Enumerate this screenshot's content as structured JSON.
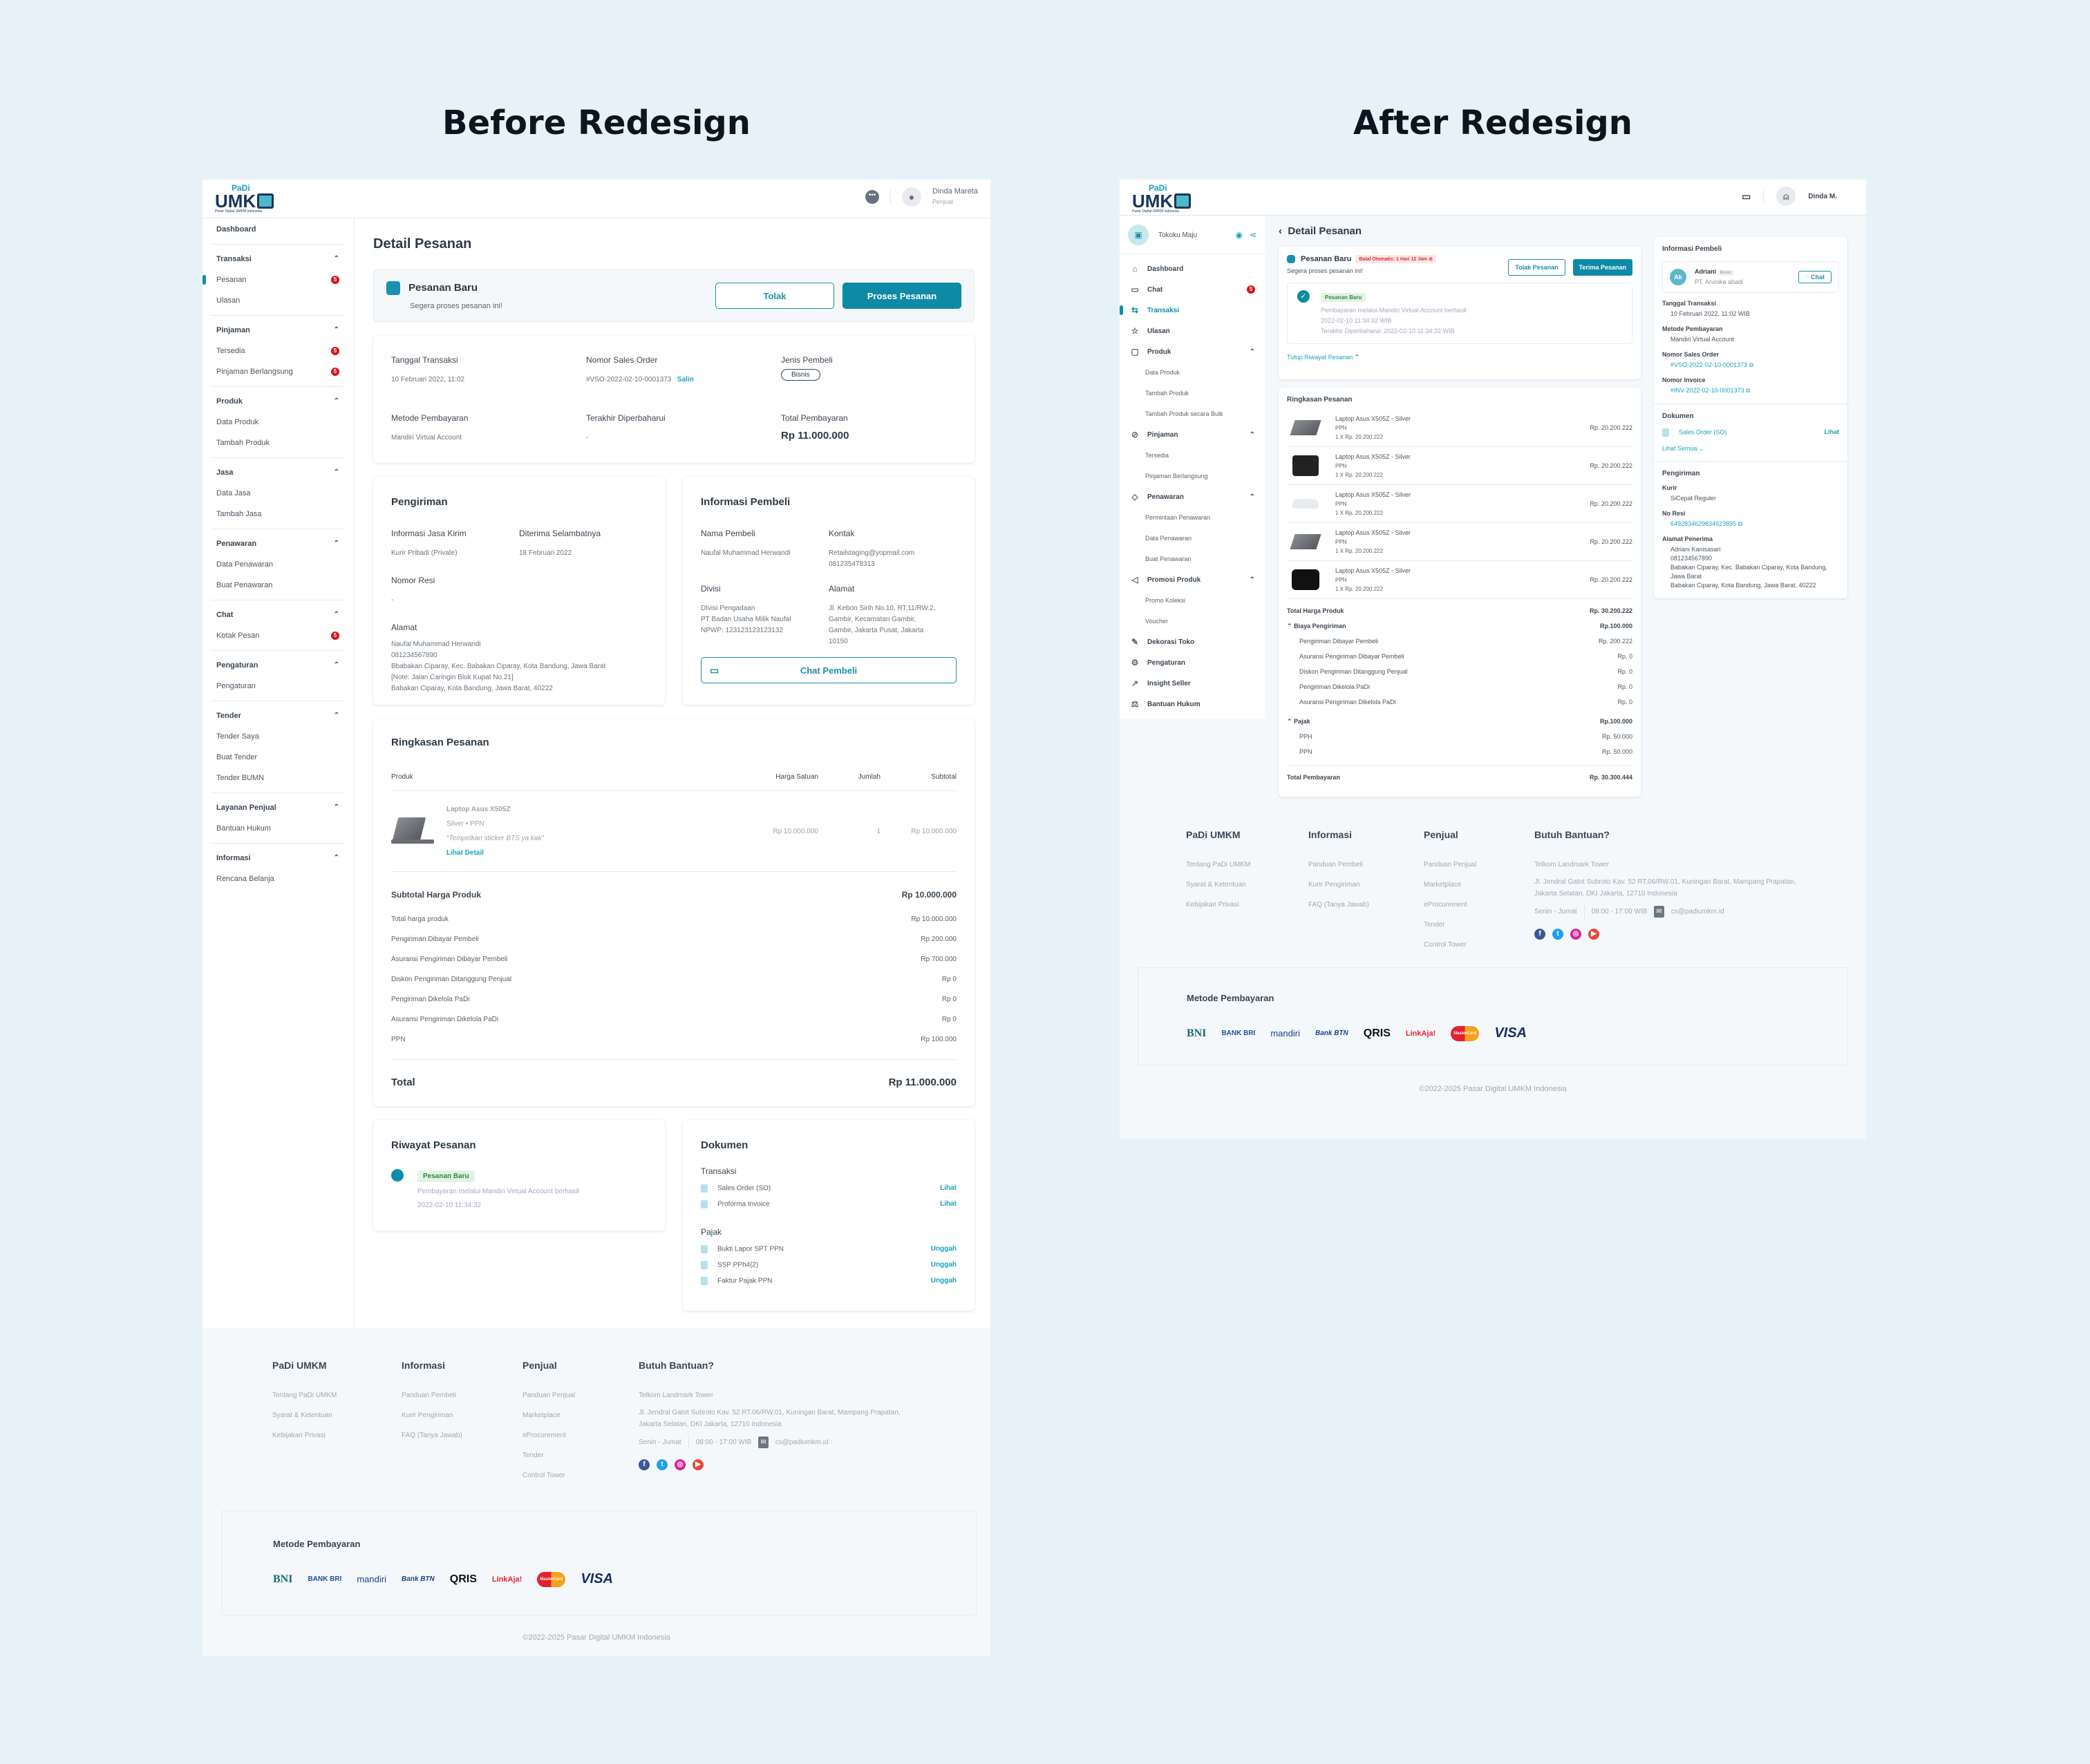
{
  "headings": {
    "before": "Before Redesign",
    "after": "After Redesign"
  },
  "brand": {
    "small": "PaDi",
    "big": "UMK",
    "tagline": "Pasar Digital UMKM Indonesia"
  },
  "before": {
    "user": {
      "name": "Dinda Mareta",
      "role": "Penjual"
    },
    "sidebar": [
      {
        "title": "Dashboard",
        "items": []
      },
      {
        "title": "Transaksi",
        "items": [
          {
            "label": "Pesanan",
            "badge": "5",
            "active": true
          },
          {
            "label": "Ulasan"
          }
        ]
      },
      {
        "title": "Pinjaman",
        "items": [
          {
            "label": "Tersedia",
            "badge": "5"
          },
          {
            "label": "Pinjaman Berlangsung",
            "badge": "5"
          }
        ]
      },
      {
        "title": "Produk",
        "items": [
          {
            "label": "Data Produk"
          },
          {
            "label": "Tambah Produk"
          }
        ]
      },
      {
        "title": "Jasa",
        "items": [
          {
            "label": "Data Jasa"
          },
          {
            "label": "Tambah Jasa"
          }
        ]
      },
      {
        "title": "Penawaran",
        "items": [
          {
            "label": "Data Penawaran"
          },
          {
            "label": "Buat Penawaran"
          }
        ]
      },
      {
        "title": "Chat",
        "items": [
          {
            "label": "Kotak Pesan",
            "badge": "5"
          }
        ]
      },
      {
        "title": "Pengaturan",
        "items": [
          {
            "label": "Pengaturan"
          }
        ]
      },
      {
        "title": "Tender",
        "items": [
          {
            "label": "Tender Saya"
          },
          {
            "label": "Buat Tender"
          },
          {
            "label": "Tender BUMN"
          }
        ]
      },
      {
        "title": "Layanan Penjual",
        "items": [
          {
            "label": "Bantuan Hukum"
          }
        ]
      },
      {
        "title": "Informasi",
        "items": [
          {
            "label": "Rencana Belanja"
          }
        ]
      }
    ],
    "title": "Detail Pesanan",
    "alert": {
      "title": "Pesanan Baru",
      "subtitle": "Segera proses pesanan ini!",
      "reject": "Tolak",
      "process": "Proses Pesanan"
    },
    "info": {
      "tanggal_label": "Tanggal Transaksi",
      "tanggal": "10 Februari 2022, 11:02",
      "so_label": "Nomor Sales Order",
      "so": "#VSO-2022-02-10-0001373",
      "copy": "Salin",
      "jenis_label": "Jenis Pembeli",
      "jenis": "Bisnis",
      "metode_label": "Metode Pembayaran",
      "metode": "Mandiri Virtual Account",
      "update_label": "Terakhir Diperbaharui",
      "update": "-",
      "total_label": "Total Pembayaran",
      "total": "Rp 11.000.000"
    },
    "shipping": {
      "title": "Pengiriman",
      "jasa_label": "Informasi Jasa Kirim",
      "jasa": "Kurir Pribadi (Private)",
      "eta_label": "Diterima Selambatnya",
      "eta": "18 Februari 2022",
      "resi_label": "Nomor Resi",
      "resi": "-",
      "alamat_label": "Alamat",
      "alamat": [
        "Naufal Muhammad Herwandi",
        "081234567890",
        "Bbabakan Ciparay, Kec. Babakan Ciparay, Kota Bandung, Jawa Barat",
        "[Note: Jalan Caringin Blok Kupat No.21]",
        "Babakan Ciparay, Kota Bandung, Jawa Barat, 40222"
      ]
    },
    "buyer": {
      "title": "Informasi Pembeli",
      "nama_label": "Nama Pembeli",
      "nama": "Naufal Muhammad Herwandi",
      "kontak_label": "Kontak",
      "kontak": [
        "Retailstaging@yopmail.com",
        "081235478313"
      ],
      "divisi_label": "Divisi",
      "divisi": [
        "DIvisi Pengadaan",
        "PT Badan Usaha Milik Naufal",
        "NPWP: 123123123123132"
      ],
      "alamat_label": "Alamat",
      "alamat": [
        "Jl. Kebon Sirih No.10, RT.11/RW.2,",
        "Gambir, Kecamatan Gambir,",
        "Gambir, Jakarta Pusat, Jakarta",
        "10150"
      ],
      "chat": "Chat Pembeli"
    },
    "summary": {
      "title": "Ringkasan Pesanan",
      "columns": [
        "Produk",
        "Harga Satuan",
        "Jumlah",
        "Subtotal"
      ],
      "product": {
        "name": "Laptop Asus X505Z",
        "variant": "Silver",
        "tax": "PPN",
        "note": "“Tempelkan sticker BTS ya kak”",
        "detail": "Lihat Detail",
        "price": "Rp 10.000.000",
        "qty": "1",
        "subtotal": "Rp 10.000.000"
      },
      "subtotal": {
        "label": "Subtotal Harga Produk",
        "value": "Rp 10.000.000"
      },
      "lines": [
        {
          "label": "Total harga produk",
          "value": "Rp 10.000.000"
        },
        {
          "label": "Pengiriman Dibayar Pembeli",
          "value": "Rp 200.000"
        },
        {
          "label": "Asuransi Pengiriman Dibayar Pembeli",
          "value": "Rp 700.000"
        },
        {
          "label": "Diskon Pengiriman Ditanggung Penjual",
          "value": "Rp 0"
        },
        {
          "label": "Pengiriman Dikelola PaDi",
          "value": "Rp 0"
        },
        {
          "label": "Asuransi Pengiriman Dikelola PaDi",
          "value": "Rp 0"
        },
        {
          "label": "PPN",
          "value": "Rp 100.000"
        }
      ],
      "total": {
        "label": "Total",
        "value": "Rp 11.000.000"
      }
    },
    "history": {
      "title": "Riwayat Pesanan",
      "status": "Pesanan Baru",
      "desc": "Pembayaran melalui Mandiri Virtual Account berhasil",
      "time": "2022-02-10 11:34:32"
    },
    "docs": {
      "title": "Dokumen",
      "groups": [
        {
          "title": "Transaksi",
          "items": [
            {
              "label": "Sales Order (SO)",
              "action": "Lihat"
            },
            {
              "label": "Proforma Invoice",
              "action": "Lihat"
            }
          ]
        },
        {
          "title": "Pajak",
          "items": [
            {
              "label": "Bukti Lapor SPT PPN",
              "action": "Unggah"
            },
            {
              "label": "SSP PPh4(2)",
              "action": "Unggah"
            },
            {
              "label": "Faktur Pajak PPN",
              "action": "Unggah"
            }
          ]
        }
      ]
    }
  },
  "footer": {
    "cols": [
      {
        "title": "PaDi UMKM",
        "items": [
          "Tentang PaDi UMKM",
          "Syarat & Ketentuan",
          "Kebijakan Privasi"
        ]
      },
      {
        "title": "Informasi",
        "items": [
          "Panduan Pembeli",
          "Kurir Pengiriman",
          "FAQ (Tanya Jawab)"
        ]
      },
      {
        "title": "Penjual",
        "items": [
          "Panduan Penjual",
          "Marketplace",
          "eProcurement",
          "Tender",
          "Control Tower"
        ]
      }
    ],
    "help": {
      "title": "Butuh Bantuan?",
      "place": "Telkom Landmark Tower",
      "address": "Jl. Jendral Gatot Subroto Kav. 52 RT.06/RW.01, Kuningan Barat, Mampang Prapatan, Jakarta Selatan, DKI Jakarta, 12710 Indonesia",
      "days": "Senin - Jumat",
      "hours": "08:00 - 17:00 WIB",
      "email": "cs@padiumkm.id"
    },
    "socials": [
      "facebook",
      "twitter",
      "instagram",
      "youtube"
    ],
    "payment_title": "Metode Pembayaran",
    "payments": [
      "BNI",
      "BANK BRI",
      "mandiri",
      "Bank BTN",
      "QRIS",
      "LinkAja!",
      "MasterCard",
      "VISA"
    ],
    "copyright": "©2022-2025 Pasar Digital UMKM Indonesia"
  },
  "after": {
    "user": {
      "name": "Dinda M."
    },
    "shop": {
      "name": "Tokoku Maju"
    },
    "sidebar": [
      {
        "label": "Dashboard",
        "icon": "home"
      },
      {
        "label": "Chat",
        "icon": "chat",
        "badge": "5"
      },
      {
        "label": "Transaksi",
        "icon": "transaction",
        "active": true
      },
      {
        "label": "Ulasan",
        "icon": "star"
      },
      {
        "label": "Produk",
        "icon": "bag",
        "sub": [
          "Data Produk",
          "Tambah Produk",
          "Tambah Produk secara Bulk"
        ]
      },
      {
        "label": "Pinjaman",
        "icon": "loan",
        "sub": [
          "Tersedia",
          "Pinjaman Berlangsung"
        ]
      },
      {
        "label": "Penawaran",
        "icon": "tag",
        "sub": [
          "Permintaan Penawaran",
          "Data Penawaran",
          "Buat Penawaran"
        ]
      },
      {
        "label": "Promosi Produk",
        "icon": "megaphone",
        "sub": [
          "Promo Koleksi",
          "Voucher"
        ]
      },
      {
        "label": "Dekorasi Toko",
        "icon": "brush"
      },
      {
        "label": "Pengaturan",
        "icon": "gear"
      },
      {
        "label": "Insight Seller",
        "icon": "trend"
      },
      {
        "label": "Bantuan Hukum",
        "icon": "scale"
      }
    ],
    "title": "Detail Pesanan",
    "status": {
      "title": "Pesanan Baru",
      "timer": "Batal Otomatis: 1 Hari 12 Jam",
      "subtitle": "Segera proses pesanan ini!",
      "reject": "Tolak Pesanan",
      "accept": "Terima Pesanan",
      "history_tag": "Pesanan Baru",
      "history_desc": "Pembayaran melalui Mandiri Virtual Account berhasil",
      "history_time": "2022-02-10 11:34:32 WIB",
      "history_update": "Terakhir Diperbaharui: 2022-02-10 11:34:32 WIB",
      "toggle": "Tutup Riwayat Pesanan"
    },
    "summary": {
      "title": "Ringkasan Pesanan",
      "products": [
        {
          "name": "Laptop Asus X505Z - Silver",
          "tax": "PPN",
          "qty": "1 X Rp. 20.200.222",
          "price": "Rp. 20.200.222",
          "img": "laptop"
        },
        {
          "name": "Laptop Asus X505Z - Silver",
          "tax": "PPN",
          "qty": "1 X Rp. 20.200.222",
          "price": "Rp. 20.200.222",
          "img": "camera"
        },
        {
          "name": "Laptop Asus X505Z - Silver",
          "tax": "PPN",
          "qty": "1 X Rp. 20.200.222",
          "price": "Rp. 20.200.222",
          "img": "shoe"
        },
        {
          "name": "Laptop Asus X505Z - Silver",
          "tax": "PPN",
          "qty": "1 X Rp. 20.200.222",
          "price": "Rp. 20.200.222",
          "img": "laptop"
        },
        {
          "name": "Laptop Asus X505Z - Silver",
          "tax": "PPN",
          "qty": "1 X Rp. 20.200.222",
          "price": "Rp. 20.200.222",
          "img": "bag"
        }
      ],
      "total_products": {
        "label": "Total Harga Produk",
        "value": "Rp. 30.200.222"
      },
      "shipping": {
        "label": "Biaya Pengiriman",
        "value": "Rp.100.000",
        "lines": [
          {
            "label": "Pengiriman Dibayar Pembeli",
            "value": "Rp. 200.222"
          },
          {
            "label": "Asuransi Pengiriman Dibayar Pembeli",
            "value": "Rp. 0"
          },
          {
            "label": "Diskon Pengiriman Ditanggung Penjual",
            "value": "Rp. 0"
          },
          {
            "label": "Pengiriman Dikelola PaDi",
            "value": "Rp. 0"
          },
          {
            "label": "Asuransi Pengiriman Dikelola PaDi",
            "value": "Rp. 0"
          }
        ]
      },
      "tax": {
        "label": "Pajak",
        "value": "Rp.100.000",
        "lines": [
          {
            "label": "PPH",
            "value": "Rp. 50.000"
          },
          {
            "label": "PPN",
            "value": "Rp. 50.000"
          }
        ]
      },
      "total": {
        "label": "Total Pembayaran",
        "value": "Rp. 30.300.444"
      }
    },
    "buyer": {
      "title": "Informasi Pembeli",
      "initials": "Ak",
      "name": "Adriani",
      "type": "Bisnis",
      "company": "PT. Arunika abadi",
      "chat": "Chat",
      "tanggal_label": "Tanggal Transaksi",
      "tanggal": "10 Februari 2022, 11:02 WIB",
      "metode_label": "Metode Pembayaran",
      "metode": "Mandiri Virtual Account",
      "so_label": "Nomor Sales Order",
      "so": "#VSO-2022-02-10-0001373",
      "inv_label": "Nomor Invoice",
      "inv": "#INV-2022-02-10-0001373"
    },
    "docs": {
      "title": "Dokumen",
      "item": "Sales Order (SO)",
      "action": "Lihat",
      "more": "Lihat Semua"
    },
    "shipping": {
      "title": "Pengiriman",
      "kurir_label": "Kurir",
      "kurir": "SiCepat Reguler",
      "resi_label": "No Resi",
      "resi": "6492834629834623895",
      "alamat_label": "Alamat Penerima",
      "alamat": [
        "Adriani Kanisasari",
        "081234567890",
        "Babakan Ciparay, Kec. Babakan Ciparay, Kota Bandung, Jawa Barat",
        "Babakan Ciparay, Kota Bandung, Jawa Barat, 40222"
      ]
    }
  },
  "colors": {
    "accent": "#0d8aa5",
    "link": "#1aa3bb",
    "badge": "#d3141c",
    "success": "#2c8a3b",
    "danger": "#e0282e"
  }
}
